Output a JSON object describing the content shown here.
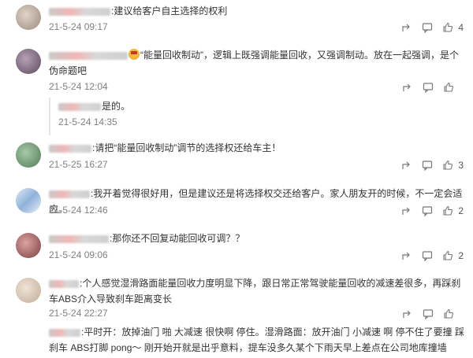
{
  "comments": [
    {
      "text": ":建议给客户自主选择的权利",
      "time": "21-5-24 09:17",
      "likes": "4",
      "avatar_color": "#b8a79c"
    },
    {
      "text": "“能量回收制动”，逻辑上既强调能量回收，又强调制动。放在一起强调，是个伪命题吧",
      "time": "21-5-24 12:04",
      "likes": "",
      "avatar_color": "#8a6b8d",
      "reply": {
        "text": "是的。",
        "time": "21-5-24 14:35"
      }
    },
    {
      "text": ":请把“能量回收制动”调节的选择权还给车主！",
      "time": "21-5-25 16:27",
      "likes": "3",
      "avatar_color": "#6e9a74"
    },
    {
      "text": ":我开着觉得很好用，但是建议还是将选择权交还给客户。家人朋友开的时候，不一定会适应。",
      "time": "21-5-24 12:46",
      "likes": "2",
      "avatar_color": "#8fb2d9"
    },
    {
      "text": ":那你还不回复动能回收可调？？",
      "time": "21-5-24 09:06",
      "likes": "2",
      "avatar_color": "#a25a5a"
    },
    {
      "text": ":个人感觉湿滑路面能量回收力度明显下降，跟日常正常驾驶能量回收的减速差很多，再踩刹车ABS介入导致刹车距离变长",
      "time": "21-5-24 22:27",
      "likes": "",
      "avatar_color": "#d9c7b6"
    },
    {
      "text": ":平时开：放掉油门 啪 大减速 很快啊 停住。湿滑路面：放开油门 小减速 啊 停不住了要撞 踩刹车 ABS打脚 pong～ 刚开始开就是出乎意料，提车没多久某个下雨天早上差点在公司地库撞墙",
      "time": "",
      "likes": "",
      "avatar_color": "#ffffff"
    }
  ]
}
